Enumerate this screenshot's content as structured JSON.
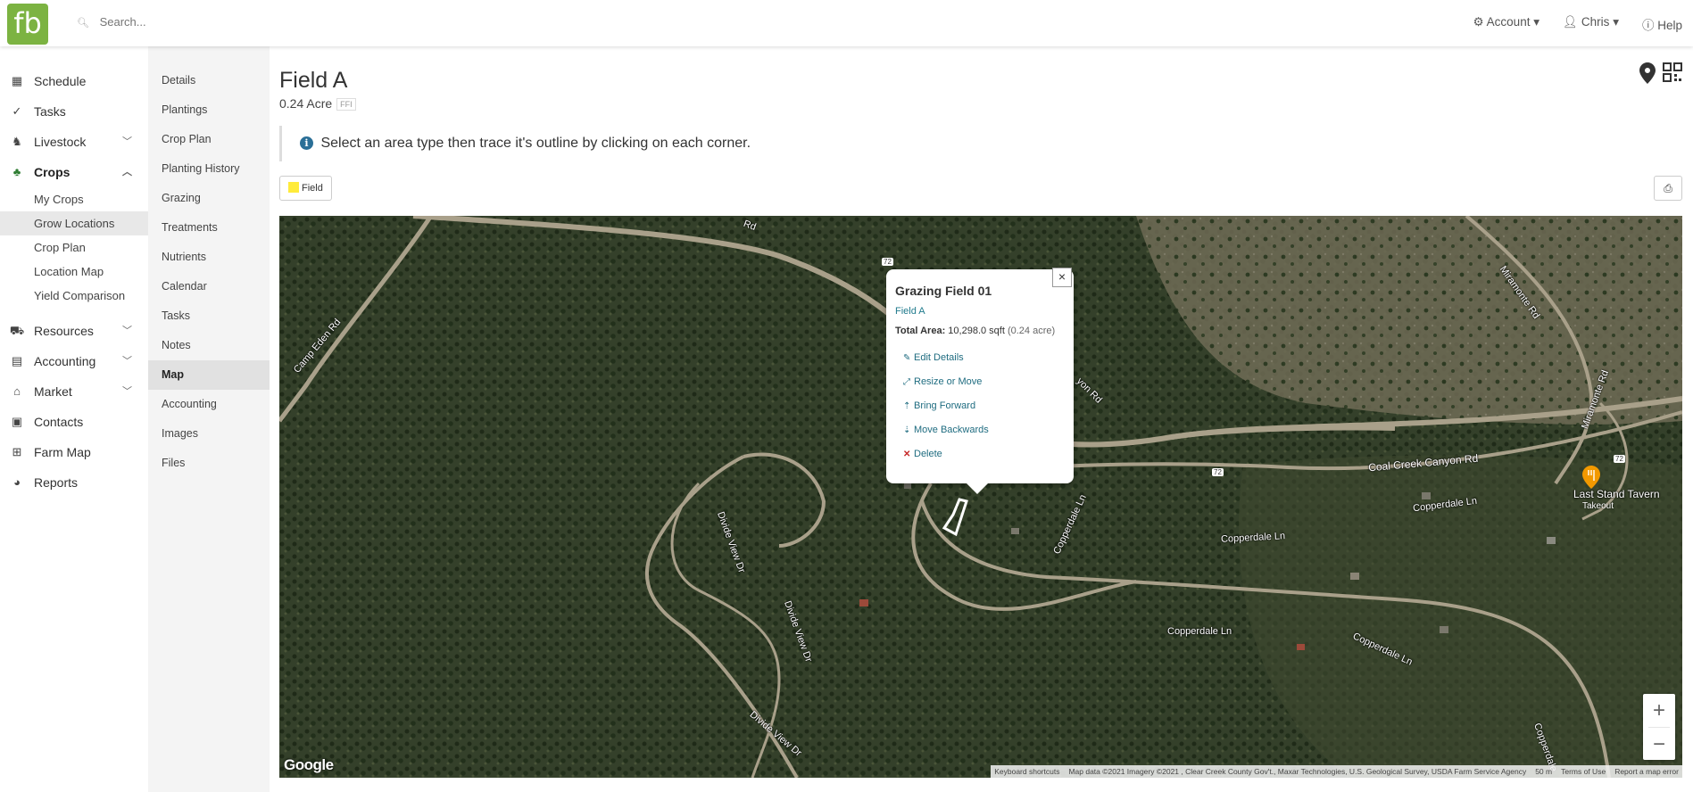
{
  "topbar": {
    "logo": "fb",
    "search_placeholder": "Search...",
    "account": "Account",
    "user": "Chris",
    "help": "Help"
  },
  "sidebar": {
    "items": [
      {
        "label": "Schedule",
        "icon": "calendar-icon"
      },
      {
        "label": "Tasks",
        "icon": "check-circle-icon"
      },
      {
        "label": "Livestock",
        "icon": "horse-icon"
      },
      {
        "label": "Crops",
        "icon": "seedling-icon"
      },
      {
        "label": "Resources",
        "icon": "tractor-icon"
      },
      {
        "label": "Accounting",
        "icon": "calculator-icon"
      },
      {
        "label": "Market",
        "icon": "store-icon"
      },
      {
        "label": "Contacts",
        "icon": "address-book-icon"
      },
      {
        "label": "Farm Map",
        "icon": "map-icon"
      },
      {
        "label": "Reports",
        "icon": "pie-chart-icon"
      }
    ],
    "crops_sub": [
      "My Crops",
      "Grow Locations",
      "Crop Plan",
      "Location Map",
      "Yield Comparison"
    ]
  },
  "sidebar2": {
    "items": [
      "Details",
      "Plantings",
      "Crop Plan",
      "Planting History",
      "Grazing",
      "Treatments",
      "Nutrients",
      "Calendar",
      "Tasks",
      "Notes",
      "Map",
      "Accounting",
      "Images",
      "Files"
    ]
  },
  "page": {
    "title": "Field A",
    "area": "0.24 Acre",
    "tag": "FFI",
    "info": "Select an area type then trace it's outline by clicking on each corner.",
    "field_button": "Field"
  },
  "popup": {
    "title": "Grazing Field 01",
    "link": "Field A",
    "area_label": "Total Area:",
    "area_value": "10,298.0 sqft",
    "area_acre": "(0.24 acre)",
    "actions": [
      "Edit Details",
      "Resize or Move",
      "Bring Forward",
      "Move Backwards",
      "Delete"
    ]
  },
  "map": {
    "roads": [
      "Rd",
      "Camp Eden Rd",
      "yon Rd",
      "Miramonte Rd",
      "Miramonte Rd",
      "Coal Creek Canyon Rd",
      "Copperdale Ln",
      "Copperdale Ln",
      "Copperdale Ln",
      "Copperdale Ln",
      "Copperdale Ln",
      "Divide View Dr",
      "Divide View Dr",
      "Divide View Dr",
      "Copperdale"
    ],
    "route_markers": [
      "72",
      "72",
      "72"
    ],
    "poi_name": "Last Stand Tavern",
    "poi_sub": "Takeout",
    "google": "Google",
    "attribution": [
      "Keyboard shortcuts",
      "Map data ©2021 Imagery ©2021 , Clear Creek County Gov't., Maxar Technologies, U.S. Geological Survey, USDA Farm Service Agency",
      "50 m",
      "Terms of Use",
      "Report a map error"
    ],
    "zoom_in": "+",
    "zoom_out": "−"
  },
  "colors": {
    "brand": "#7cb342",
    "link": "#1f7a8c",
    "field_swatch": "#ffeb3b",
    "delete": "#c62828",
    "poi": "#f29900"
  }
}
